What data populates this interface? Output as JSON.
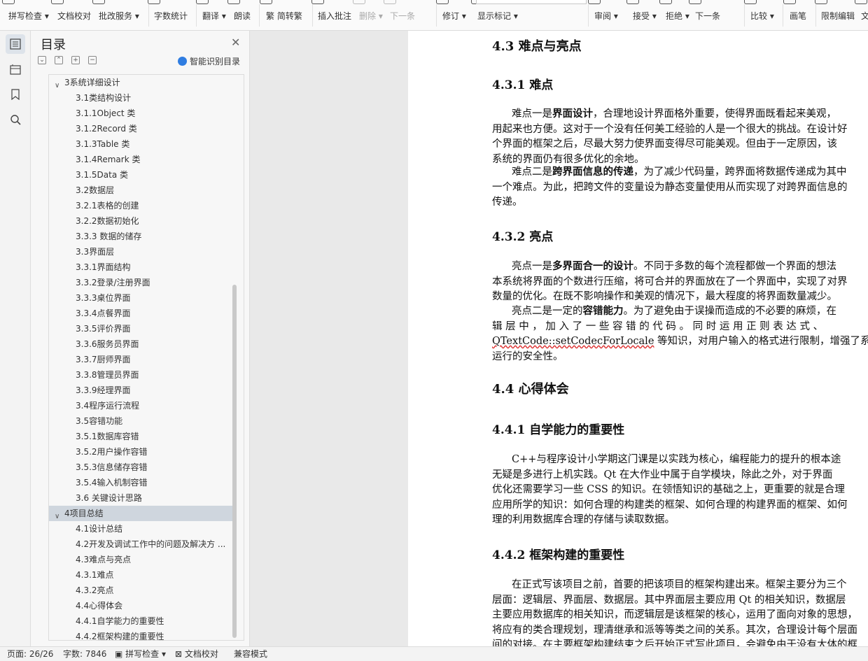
{
  "ribbon": {
    "items": [
      {
        "label": "拼写检查",
        "dropdown": true
      },
      {
        "label": "文档校对"
      },
      {
        "label": "批改服务",
        "dropdown": true
      },
      {
        "label": "字数统计"
      },
      {
        "label": "翻译",
        "dropdown": true
      },
      {
        "label": "朗读"
      },
      {
        "label": "繁 简转繁"
      },
      {
        "label": "插入批注"
      },
      {
        "label": "删除",
        "dropdown": true,
        "disabled": true
      },
      {
        "label": "下一条",
        "disabled": true
      },
      {
        "label": "修订",
        "dropdown": true
      },
      {
        "label": "显示标记",
        "dropdown": true
      },
      {
        "label": "审阅",
        "dropdown": true
      },
      {
        "label": "接受",
        "dropdown": true
      },
      {
        "label": "拒绝",
        "dropdown": true
      },
      {
        "label": "下一条"
      },
      {
        "label": "比较",
        "dropdown": true
      },
      {
        "label": "画笔"
      },
      {
        "label": "限制编辑"
      },
      {
        "label": "文"
      }
    ]
  },
  "toc": {
    "title": "目录",
    "ai_label": "智能识别目录",
    "items": [
      {
        "label": "3系统详细设计",
        "level": 1,
        "expanded": true
      },
      {
        "label": "3.1类结构设计",
        "level": 2
      },
      {
        "label": "3.1.1Object 类",
        "level": 2
      },
      {
        "label": "3.1.2Record 类",
        "level": 2
      },
      {
        "label": "3.1.3Table 类",
        "level": 2
      },
      {
        "label": "3.1.4Remark 类",
        "level": 2
      },
      {
        "label": "3.1.5Data 类",
        "level": 2
      },
      {
        "label": "3.2数据层",
        "level": 2
      },
      {
        "label": "3.2.1表格的创建",
        "level": 2
      },
      {
        "label": "3.2.2数据初始化",
        "level": 2
      },
      {
        "label": "3.3.3 数据的储存",
        "level": 2
      },
      {
        "label": "3.3界面层",
        "level": 2
      },
      {
        "label": "3.3.1界面结构",
        "level": 2
      },
      {
        "label": "3.3.2登录/注册界面",
        "level": 2
      },
      {
        "label": "3.3.3桌位界面",
        "level": 2
      },
      {
        "label": "3.3.4点餐界面",
        "level": 2
      },
      {
        "label": "3.3.5评价界面",
        "level": 2
      },
      {
        "label": "3.3.6服务员界面",
        "level": 2
      },
      {
        "label": "3.3.7厨师界面",
        "level": 2
      },
      {
        "label": "3.3.8管理员界面",
        "level": 2
      },
      {
        "label": "3.3.9经理界面",
        "level": 2
      },
      {
        "label": "3.4程序运行流程",
        "level": 2
      },
      {
        "label": "3.5容错功能",
        "level": 2
      },
      {
        "label": "3.5.1数据库容错",
        "level": 2
      },
      {
        "label": "3.5.2用户操作容错",
        "level": 2
      },
      {
        "label": "3.5.3信息储存容错",
        "level": 2
      },
      {
        "label": "3.5.4输入机制容错",
        "level": 2
      },
      {
        "label": "3.6 关键设计思路",
        "level": 2
      },
      {
        "label": "4项目总结",
        "level": 1,
        "expanded": true,
        "selected": true
      },
      {
        "label": "4.1设计总结",
        "level": 2
      },
      {
        "label": "4.2开发及调试工作中的问题及解决方 ...",
        "level": 2
      },
      {
        "label": "4.3难点与亮点",
        "level": 2
      },
      {
        "label": "4.3.1难点",
        "level": 2
      },
      {
        "label": "4.3.2亮点",
        "level": 2
      },
      {
        "label": "4.4心得体会",
        "level": 2
      },
      {
        "label": "4.4.1自学能力的重要性",
        "level": 2
      },
      {
        "label": "4.4.2框架构建的重要性",
        "level": 2
      }
    ]
  },
  "doc": {
    "h_4_3": "4.3  难点与亮点",
    "h_4_3_1": "4.3.1  难点",
    "p1": [
      {
        "pre": "难点一是",
        "bold": "界面设计",
        "post": "，合理地设计界面格外重要，使得界面既看起来美观，"
      },
      {
        "text": "用起来也方便。这对于一个没有任何美工经验的人是一个很大的挑战。在设计好"
      },
      {
        "text": "个界面的框架之后，尽最大努力使界面变得尽可能美观。但由于一定原因，该"
      },
      {
        "text": "系统的界面仍有很多优化的余地。"
      }
    ],
    "p2": [
      {
        "pre": "难点二是",
        "bold": "跨界面信息的传递",
        "post": "，为了减少代码量，跨界面将数据传递成为其中"
      },
      {
        "text": "一个难点。为此，把跨文件的变量设为静态变量使用从而实现了对跨界面信息的"
      },
      {
        "text": "传递。"
      }
    ],
    "h_4_3_2": "4.3.2  亮点",
    "p3": [
      {
        "pre": "亮点一是",
        "bold": "多界面合一的设计",
        "post": "。不同于多数的每个流程都做一个界面的想法"
      },
      {
        "text": "本系统将界面的个数进行压缩，将可合并的界面放在了一个界面中，实现了对界"
      },
      {
        "text": "数量的优化。在既不影响操作和美观的情况下，最大程度的将界面数量减少。"
      }
    ],
    "p4": [
      {
        "pre": "亮点二是一定的",
        "bold": "容错能力",
        "post": "。为了避免由于误操而造成的不必要的麻烦，在"
      },
      {
        "text": "辑 层 中 ， 加 入 了   一 些 容 错 的 代 码   。 同 时 运 用 正 则 表 达 式 、"
      },
      {
        "squiggle": "QTextCode::setCodecForLocale",
        "post": " 等知识，对用户输入的格式进行限制，增强了系"
      },
      {
        "text": "运行的安全性。"
      }
    ],
    "h_4_4": "4.4  心得体会",
    "h_4_4_1": "4.4.1  自学能力的重要性",
    "p5": [
      {
        "pre": "C++与程序设计小学期这门课是以实践为核心，编程能力的提升的根本途"
      },
      {
        "text": "无疑是多进行上机实践。Qt 在大作业中属于自学模块，除此之外，对于界面"
      },
      {
        "text": "优化还需要学习一些 CSS 的知识。在领悟知识的基础之上，更重要的就是合理"
      },
      {
        "text": "应用所学的知识：如何合理的构建类的框架、如何合理的构建界面的框架、如何"
      },
      {
        "text": "理的利用数据库合理的存储与读取数据。"
      }
    ],
    "h_4_4_2": "4.4.2  框架构建的重要性",
    "p6": [
      {
        "pre": "在正式写该项目之前，首要的把该项目的框架构建出来。框架主要分为三个"
      },
      {
        "text": "层面：逻辑层、界面层、数据层。其中界面层主要应用 Qt 的相关知识，数据层"
      },
      {
        "text": "主要应用数据库的相关知识，而逻辑层是该框架的核心，运用了面向对象的思想，"
      },
      {
        "text": "将应有的类合理规划，理清继承和派等等类之间的关系。其次，合理设计每个层面"
      },
      {
        "text": "间的对接。在主要框架构建结束之后开始正式写此项目，会避免由于没有大体的框"
      }
    ]
  },
  "status": {
    "page": "页面: 26/26",
    "words": "字数: 7846",
    "spell": "拼写检查",
    "proof": "文档校对",
    "compat": "兼容模式"
  }
}
